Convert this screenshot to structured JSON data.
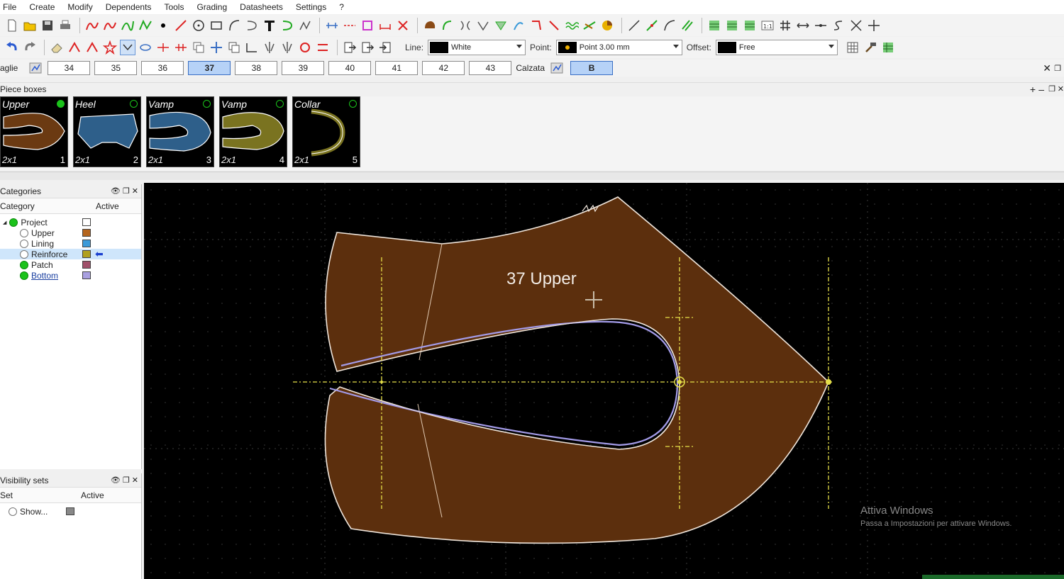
{
  "menu": [
    "File",
    "Create",
    "Modify",
    "Dependents",
    "Tools",
    "Grading",
    "Datasheets",
    "Settings",
    "?"
  ],
  "toolbar2": {
    "line_label": "Line:",
    "line_value": "White",
    "point_label": "Point:",
    "point_value": "Point 3.00 mm",
    "offset_label": "Offset:",
    "offset_value": "Free"
  },
  "sizes": {
    "label": "aglie",
    "values": [
      "34",
      "35",
      "36",
      "37",
      "38",
      "39",
      "40",
      "41",
      "42",
      "43"
    ],
    "active": "37",
    "calzata_label": "Calzata",
    "calzata_value": "B"
  },
  "piece_boxes": {
    "title": "Piece boxes",
    "items": [
      {
        "name": "Upper",
        "qty": "2x1",
        "num": "1",
        "color": "#6b3a12",
        "status": "#1bc21b"
      },
      {
        "name": "Heel",
        "qty": "2x1",
        "num": "2",
        "color": "#2e5f8a",
        "status": "none"
      },
      {
        "name": "Vamp",
        "qty": "2x1",
        "num": "3",
        "color": "#2e5f8a",
        "status": "none"
      },
      {
        "name": "Vamp",
        "qty": "2x1",
        "num": "4",
        "color": "#7a7320",
        "status": "none"
      },
      {
        "name": "Collar",
        "qty": "2x1",
        "num": "5",
        "color": "#7a7320",
        "status": "none"
      }
    ]
  },
  "categories": {
    "title": "Categories",
    "col_category": "Category",
    "col_active": "Active",
    "items": [
      {
        "label": "Project",
        "level": 0,
        "on": true,
        "color": "#ffffff"
      },
      {
        "label": "Upper",
        "level": 1,
        "on": false,
        "color": "#b5651d"
      },
      {
        "label": "Lining",
        "level": 1,
        "on": false,
        "color": "#3a9ad9"
      },
      {
        "label": "Reinforce",
        "level": 1,
        "on": false,
        "color": "#b0a020"
      },
      {
        "label": "Patch",
        "level": 1,
        "on": true,
        "color": "#a0506a"
      },
      {
        "label": "Bottom",
        "level": 1,
        "on": true,
        "color": "#a9a0e0"
      }
    ]
  },
  "visibility_sets": {
    "title": "Visibility sets",
    "col_set": "Set",
    "col_active": "Active",
    "items": [
      {
        "label": "Show...",
        "color": "#888888"
      }
    ]
  },
  "canvas": {
    "piece_label": "37 Upper",
    "fill_color": "#5c2f0d",
    "watermark_title": "Attiva Windows",
    "watermark_sub": "Passa a Impostazioni per attivare Windows."
  }
}
